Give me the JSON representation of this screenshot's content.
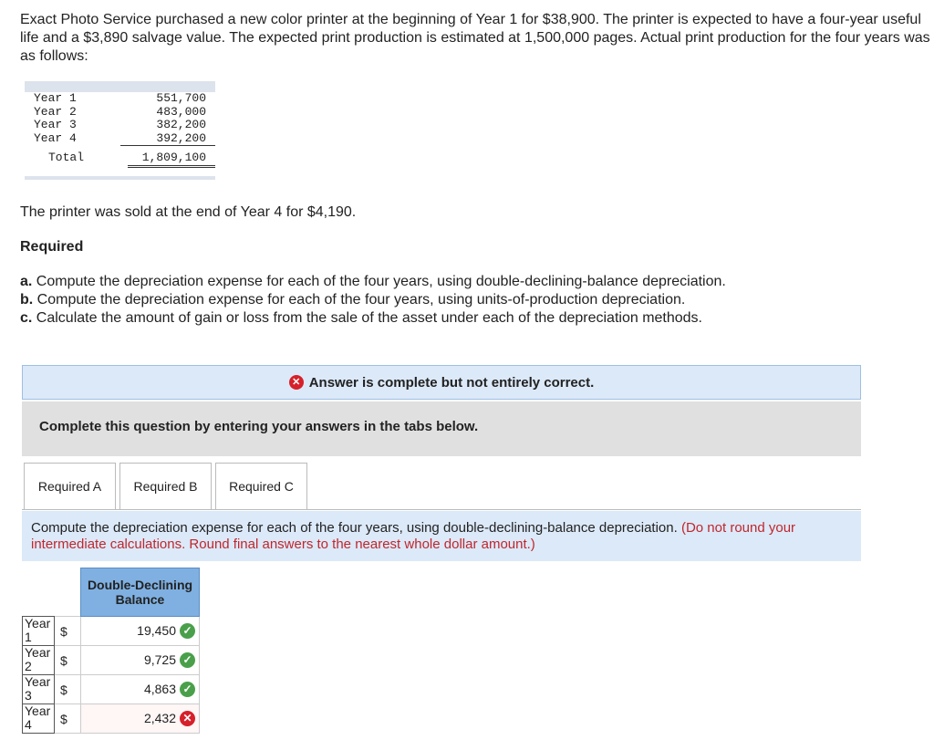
{
  "intro": "Exact Photo Service purchased a new color printer at the beginning of Year 1 for $38,900. The printer is expected to have a four-year useful life and a $3,890 salvage value. The expected print production is estimated at 1,500,000 pages. Actual print production for the four years was as follows:",
  "production": [
    {
      "label": "Year 1",
      "value": "551,700"
    },
    {
      "label": "Year 2",
      "value": "483,000"
    },
    {
      "label": "Year 3",
      "value": "382,200"
    },
    {
      "label": "Year 4",
      "value": "392,200"
    }
  ],
  "production_total": {
    "label": "Total",
    "value": "1,809,100"
  },
  "sold_text": "The printer was sold at the end of Year 4 for $4,190.",
  "required_heading": "Required",
  "requirements": [
    {
      "letter": "a.",
      "text": " Compute the depreciation expense for each of the four years, using double-declining-balance depreciation."
    },
    {
      "letter": "b.",
      "text": " Compute the depreciation expense for each of the four years, using units-of-production depreciation."
    },
    {
      "letter": "c.",
      "text": " Calculate the amount of gain or loss from the sale of the asset under each of the depreciation methods."
    }
  ],
  "answer_banner": "Answer is complete but not entirely correct.",
  "complete_prompt": "Complete this question by entering your answers in the tabs below.",
  "tabs": [
    "Required A",
    "Required B",
    "Required C"
  ],
  "instruction": "Compute the depreciation expense for each of the four years, using double-declining-balance depreciation.",
  "instruction_note": "(Do not round your intermediate calculations. Round final answers to the nearest whole dollar amount.)",
  "ddb_header": "Double-Declining Balance",
  "ddb_rows": [
    {
      "year": "Year 1",
      "currency": "$",
      "value": "19,450",
      "status": "correct"
    },
    {
      "year": "Year 2",
      "currency": "$",
      "value": "9,725",
      "status": "correct"
    },
    {
      "year": "Year 3",
      "currency": "$",
      "value": "4,863",
      "status": "correct"
    },
    {
      "year": "Year 4",
      "currency": "$",
      "value": "2,432",
      "status": "incorrect"
    }
  ],
  "colors": {
    "banner_bg": "#dce9f8",
    "header_bg": "#7fb0e1",
    "correct": "#4aa04a",
    "incorrect": "#d6202a",
    "note_red": "#c0262d"
  }
}
